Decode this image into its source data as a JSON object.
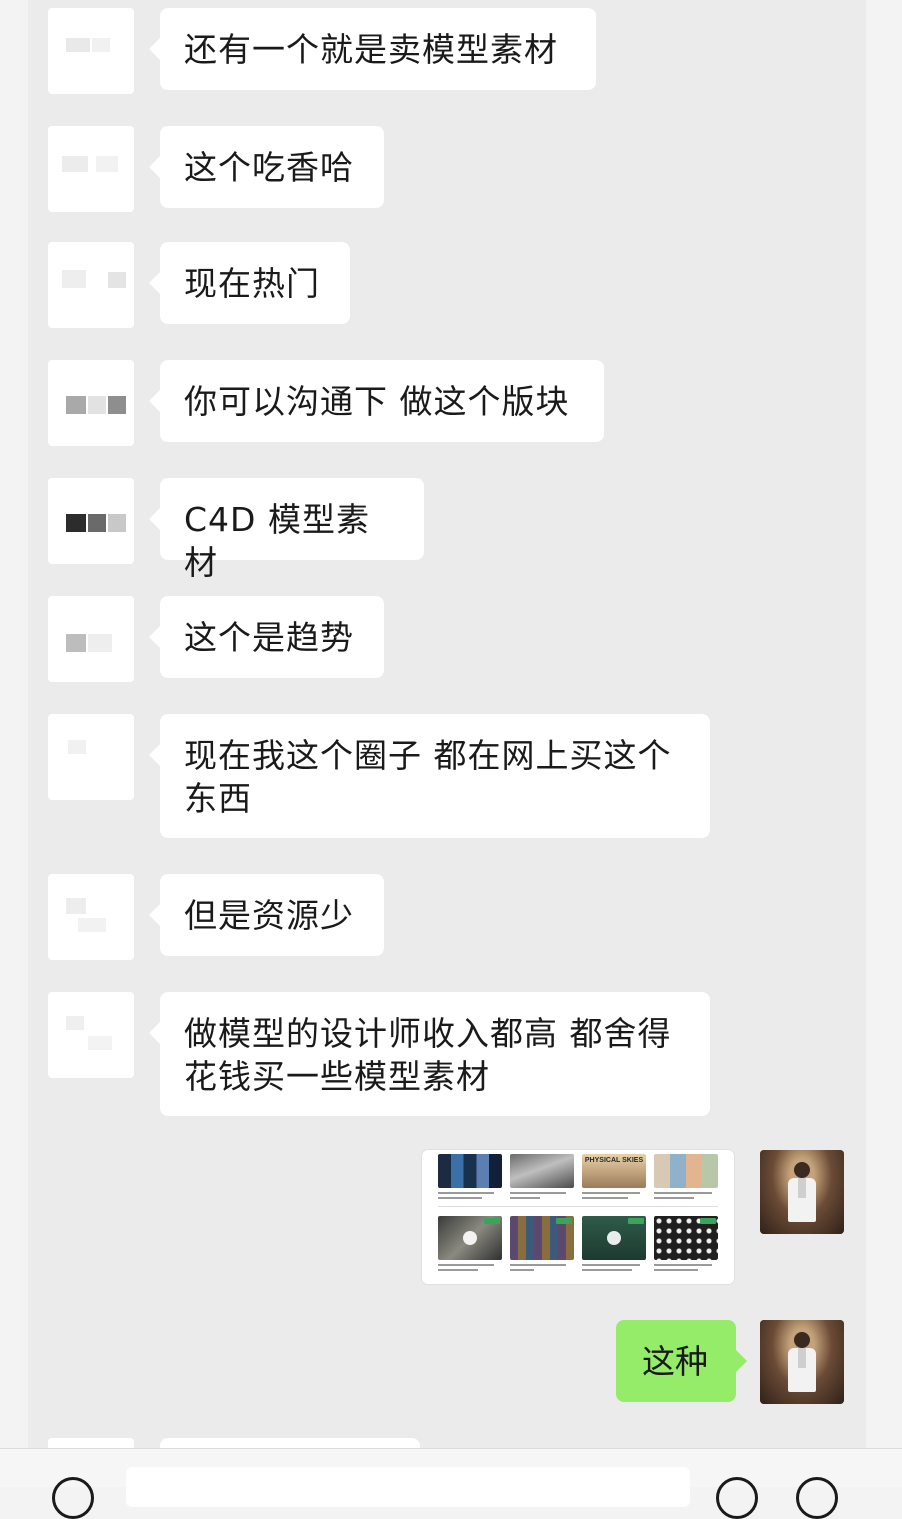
{
  "chat": {
    "messages": [
      {
        "side": "left",
        "text": "还有一个就是卖模型素材"
      },
      {
        "side": "left",
        "text": "这个吃香哈"
      },
      {
        "side": "left",
        "text": "现在热门"
      },
      {
        "side": "left",
        "text": "你可以沟通下 做这个版块"
      },
      {
        "side": "left",
        "text": "C4D 模型素材"
      },
      {
        "side": "left",
        "text": "这个是趋势"
      },
      {
        "side": "left",
        "text": "现在我这个圈子 都在网上买这个东西"
      },
      {
        "side": "left",
        "text": "但是资源少"
      },
      {
        "side": "left",
        "text": "做模型的设计师收入都高 都舍得花钱买一些模型素材"
      },
      {
        "side": "right",
        "type": "image",
        "shared_image_text": "PHYSICAL SKIES"
      },
      {
        "side": "right",
        "text": "这种"
      }
    ]
  },
  "colors": {
    "chat_background": "#ebebeb",
    "incoming_bubble": "#ffffff",
    "outgoing_bubble": "#95ec69",
    "text": "#1a1a1a"
  },
  "icons": [
    "voice-icon",
    "emoji-icon",
    "plus-icon"
  ]
}
